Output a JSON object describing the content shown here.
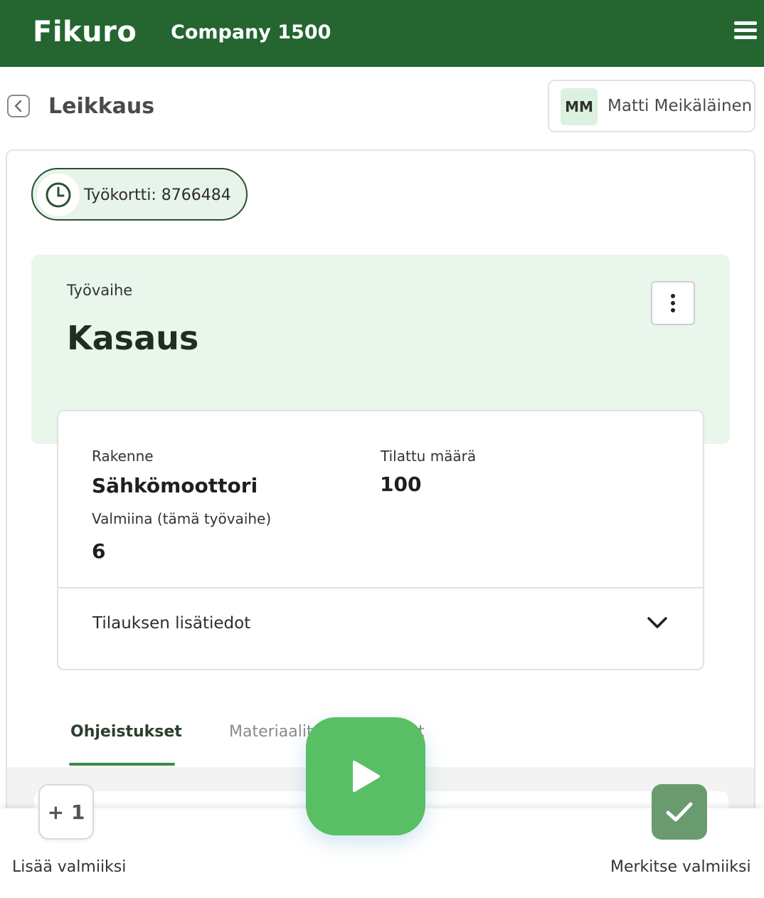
{
  "header": {
    "brand": "Fikuro",
    "company": "Company 1500",
    "menu_icon": "hamburger-menu-icon"
  },
  "subheader": {
    "back_icon": "chevron-left-icon",
    "title": "Leikkaus",
    "user": {
      "initials": "MM",
      "name": "Matti Meikäläinen"
    }
  },
  "workcard": {
    "icon": "clock-icon",
    "label": "Työkortti: 8766484"
  },
  "phase": {
    "label": "Työvaihe",
    "name": "Kasaus",
    "menu_icon": "more-vertical-icon"
  },
  "details": {
    "structure_label": "Rakenne",
    "structure_value": "Sähkömoottori",
    "ordered_label": "Tilattu määrä",
    "ordered_value": "100",
    "done_label": "Valmiina (tämä työvaihe)",
    "done_value": "6",
    "accordion_label": "Tilauksen lisätiedot",
    "accordion_icon": "chevron-down-icon"
  },
  "tabs": [
    {
      "label": "Ohjeistukset",
      "active": true
    },
    {
      "label": "Materiaalit",
      "active": false
    },
    {
      "label": "t",
      "active": false
    }
  ],
  "actions": {
    "add_icon_text": "+ 1",
    "add_label": "Lisää valmiiksi",
    "play_icon": "play-icon",
    "done_icon": "checkmark-icon",
    "done_label": "Merkitse valmiiksi"
  },
  "colors": {
    "header_bg": "#246530",
    "accent_green": "#58bf64",
    "panel_bg": "#e9f6eb",
    "done_btn": "#6a9b6f"
  }
}
